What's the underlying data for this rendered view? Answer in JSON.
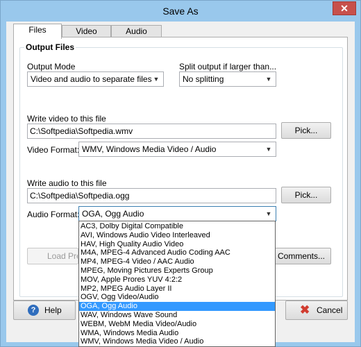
{
  "window": {
    "title": "Save As",
    "close_glyph": "✕"
  },
  "tabs": [
    {
      "label": "Files",
      "active": true
    },
    {
      "label": "Video",
      "active": false
    },
    {
      "label": "Audio",
      "active": false
    }
  ],
  "group": {
    "title": "Output Files"
  },
  "output_mode": {
    "label": "Output Mode",
    "value": "Video and audio to separate files"
  },
  "split": {
    "label": "Split output if larger than...",
    "value": "No splitting"
  },
  "video": {
    "write_label": "Write video to this file",
    "path": "C:\\Softpedia\\Softpedia.wmv",
    "pick_label": "Pick...",
    "format_label": "Video Format:",
    "format_value": "WMV, Windows Media Video / Audio"
  },
  "audio": {
    "write_label": "Write audio to this file",
    "path": "C:\\Softpedia\\Softpedia.ogg",
    "pick_label": "Pick...",
    "format_label": "Audio Format:",
    "format_value": "OGA, Ogg Audio"
  },
  "audio_format_options": [
    "AC3, Dolby Digital Compatible",
    "AVI, Windows Audio Video Interleaved",
    "HAV, High Quality Audio Video",
    "M4A, MPEG-4 Advanced Audio Coding AAC",
    "MP4, MPEG-4 Video / AAC Audio",
    "MPEG, Moving Pictures Experts Group",
    "MOV, Apple Prores YUV 4:2:2",
    "MP2, MPEG Audio Layer II",
    "OGV, Ogg Video/Audio",
    "OGA, Ogg Audio",
    "WAV, Windows Wave Sound",
    "WEBM, WebM Media Video/Audio",
    "WMA, Windows Media Audio",
    "WMV, Windows Media Video / Audio"
  ],
  "selected_option_index": 9,
  "partial_buttons": {
    "load_label": "Load Pre",
    "comments_label": "Comments..."
  },
  "bottom": {
    "help_label": "Help",
    "cancel_label": "Cancel"
  },
  "icons": {
    "help": "help-icon",
    "cancel": "cancel-icon",
    "dropdown_arrow": "chevron-down-icon"
  }
}
